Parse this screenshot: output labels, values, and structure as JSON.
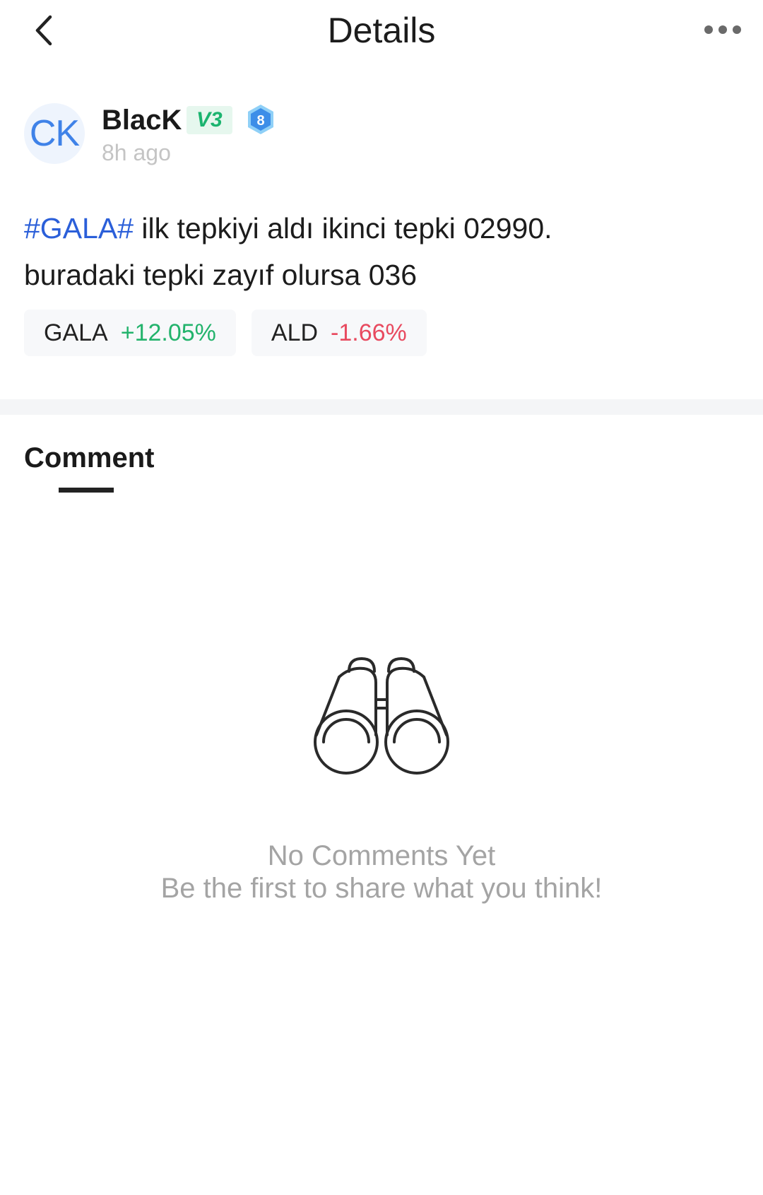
{
  "header": {
    "title": "Details",
    "back_icon": "chevron-left-icon",
    "more_icon": "more-horizontal-icon"
  },
  "author": {
    "avatar_initials": "CK",
    "name": "BlacK",
    "vip_label": "V3",
    "level": "8",
    "time": "8h ago"
  },
  "post": {
    "hashtag": "#GALA#",
    "line1": " ilk tepkiyi aldı ikinci tepki 02990.",
    "line2": "buradaki tepki zayıf olursa 036"
  },
  "tickers": [
    {
      "symbol": "GALA",
      "change": "+12.05%",
      "direction": "up"
    },
    {
      "symbol": "ALD",
      "change": "-1.66%",
      "direction": "down"
    }
  ],
  "comments": {
    "tab_label": "Comment",
    "empty_title": "No Comments Yet",
    "empty_subtitle": "Be the first to share what you think!",
    "empty_icon": "binoculars-icon"
  },
  "colors": {
    "hashtag": "#2b5fd9",
    "up": "#23b36c",
    "down": "#e84a5f",
    "avatar": "#3f82e8"
  }
}
